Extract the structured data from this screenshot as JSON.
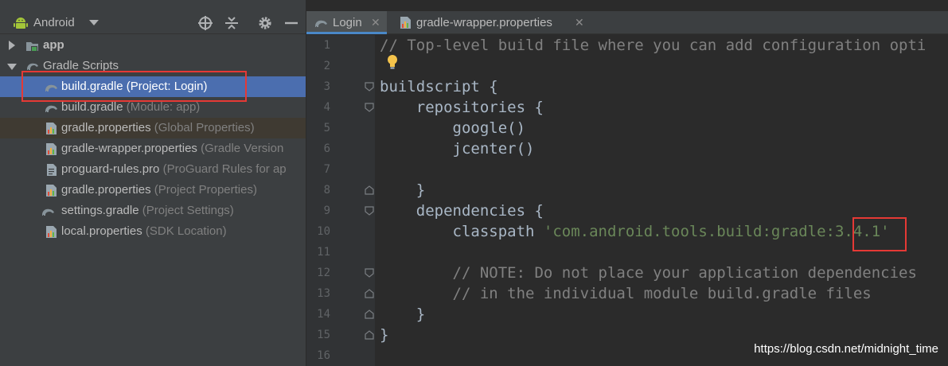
{
  "window": {
    "project_title": "Android",
    "header_buttons": [
      "target-icon",
      "collapse-all-icon",
      "gear-icon",
      "minimize-icon"
    ]
  },
  "tree": {
    "items": [
      {
        "name": "app",
        "hint": "",
        "icon": "module-folder-icon",
        "expander": "collapsed"
      },
      {
        "name": "Gradle Scripts",
        "hint": "",
        "icon": "gradle-scripts-icon",
        "expander": "expanded"
      },
      {
        "name": "build.gradle",
        "hint": "(Project: Login)",
        "icon": "gradle-icon",
        "state": "selected"
      },
      {
        "name": "build.gradle",
        "hint": "(Module: app)",
        "icon": "gradle-icon"
      },
      {
        "name": "gradle.properties",
        "hint": "(Global Properties)",
        "icon": "properties-icon",
        "state": "lint"
      },
      {
        "name": "gradle-wrapper.properties",
        "hint": "(Gradle Version",
        "icon": "properties-icon"
      },
      {
        "name": "proguard-rules.pro",
        "hint": "(ProGuard Rules for ap",
        "icon": "text-file-icon"
      },
      {
        "name": "gradle.properties",
        "hint": "(Project Properties)",
        "icon": "properties-icon"
      },
      {
        "name": "settings.gradle",
        "hint": "(Project Settings)",
        "icon": "gradle-icon"
      },
      {
        "name": "local.properties",
        "hint": "(SDK Location)",
        "icon": "properties-icon"
      }
    ]
  },
  "editor": {
    "tabs": [
      {
        "label": "Login",
        "icon": "gradle-icon",
        "active": true
      },
      {
        "label": "gradle-wrapper.properties",
        "icon": "properties-icon",
        "active": false
      }
    ],
    "line_numbers": [
      "1",
      "2",
      "3",
      "4",
      "5",
      "6",
      "7",
      "8",
      "9",
      "10",
      "11",
      "12",
      "13",
      "14",
      "15",
      "16"
    ],
    "lines": [
      [
        {
          "t": "// Top-level build file where you can add configuration opti",
          "c": "cm"
        }
      ],
      [],
      [
        {
          "t": "buildscript {",
          "c": "tx"
        }
      ],
      [
        {
          "t": "    repositories {",
          "c": "tx"
        }
      ],
      [
        {
          "t": "        google()",
          "c": "tx"
        }
      ],
      [
        {
          "t": "        jcenter()",
          "c": "tx"
        }
      ],
      [],
      [
        {
          "t": "    }",
          "c": "tx"
        }
      ],
      [
        {
          "t": "    dependencies {",
          "c": "tx"
        }
      ],
      [
        {
          "t": "        classpath ",
          "c": "tx"
        },
        {
          "t": "'com.android.tools.build:gradle:3.4.1'",
          "c": "st"
        }
      ],
      [],
      [
        {
          "t": "        // NOTE: Do not place your application dependencies",
          "c": "cm"
        }
      ],
      [
        {
          "t": "        // in the individual module build.gradle files",
          "c": "cm"
        }
      ],
      [
        {
          "t": "    }",
          "c": "tx"
        }
      ],
      [
        {
          "t": "}",
          "c": "tx"
        }
      ],
      []
    ],
    "watermark": "https://blog.csdn.net/midnight_time"
  },
  "colors": {
    "selection": "#4b6eaf",
    "annotation_red": "#e53935",
    "string": "#6a8759",
    "comment": "#808080"
  }
}
